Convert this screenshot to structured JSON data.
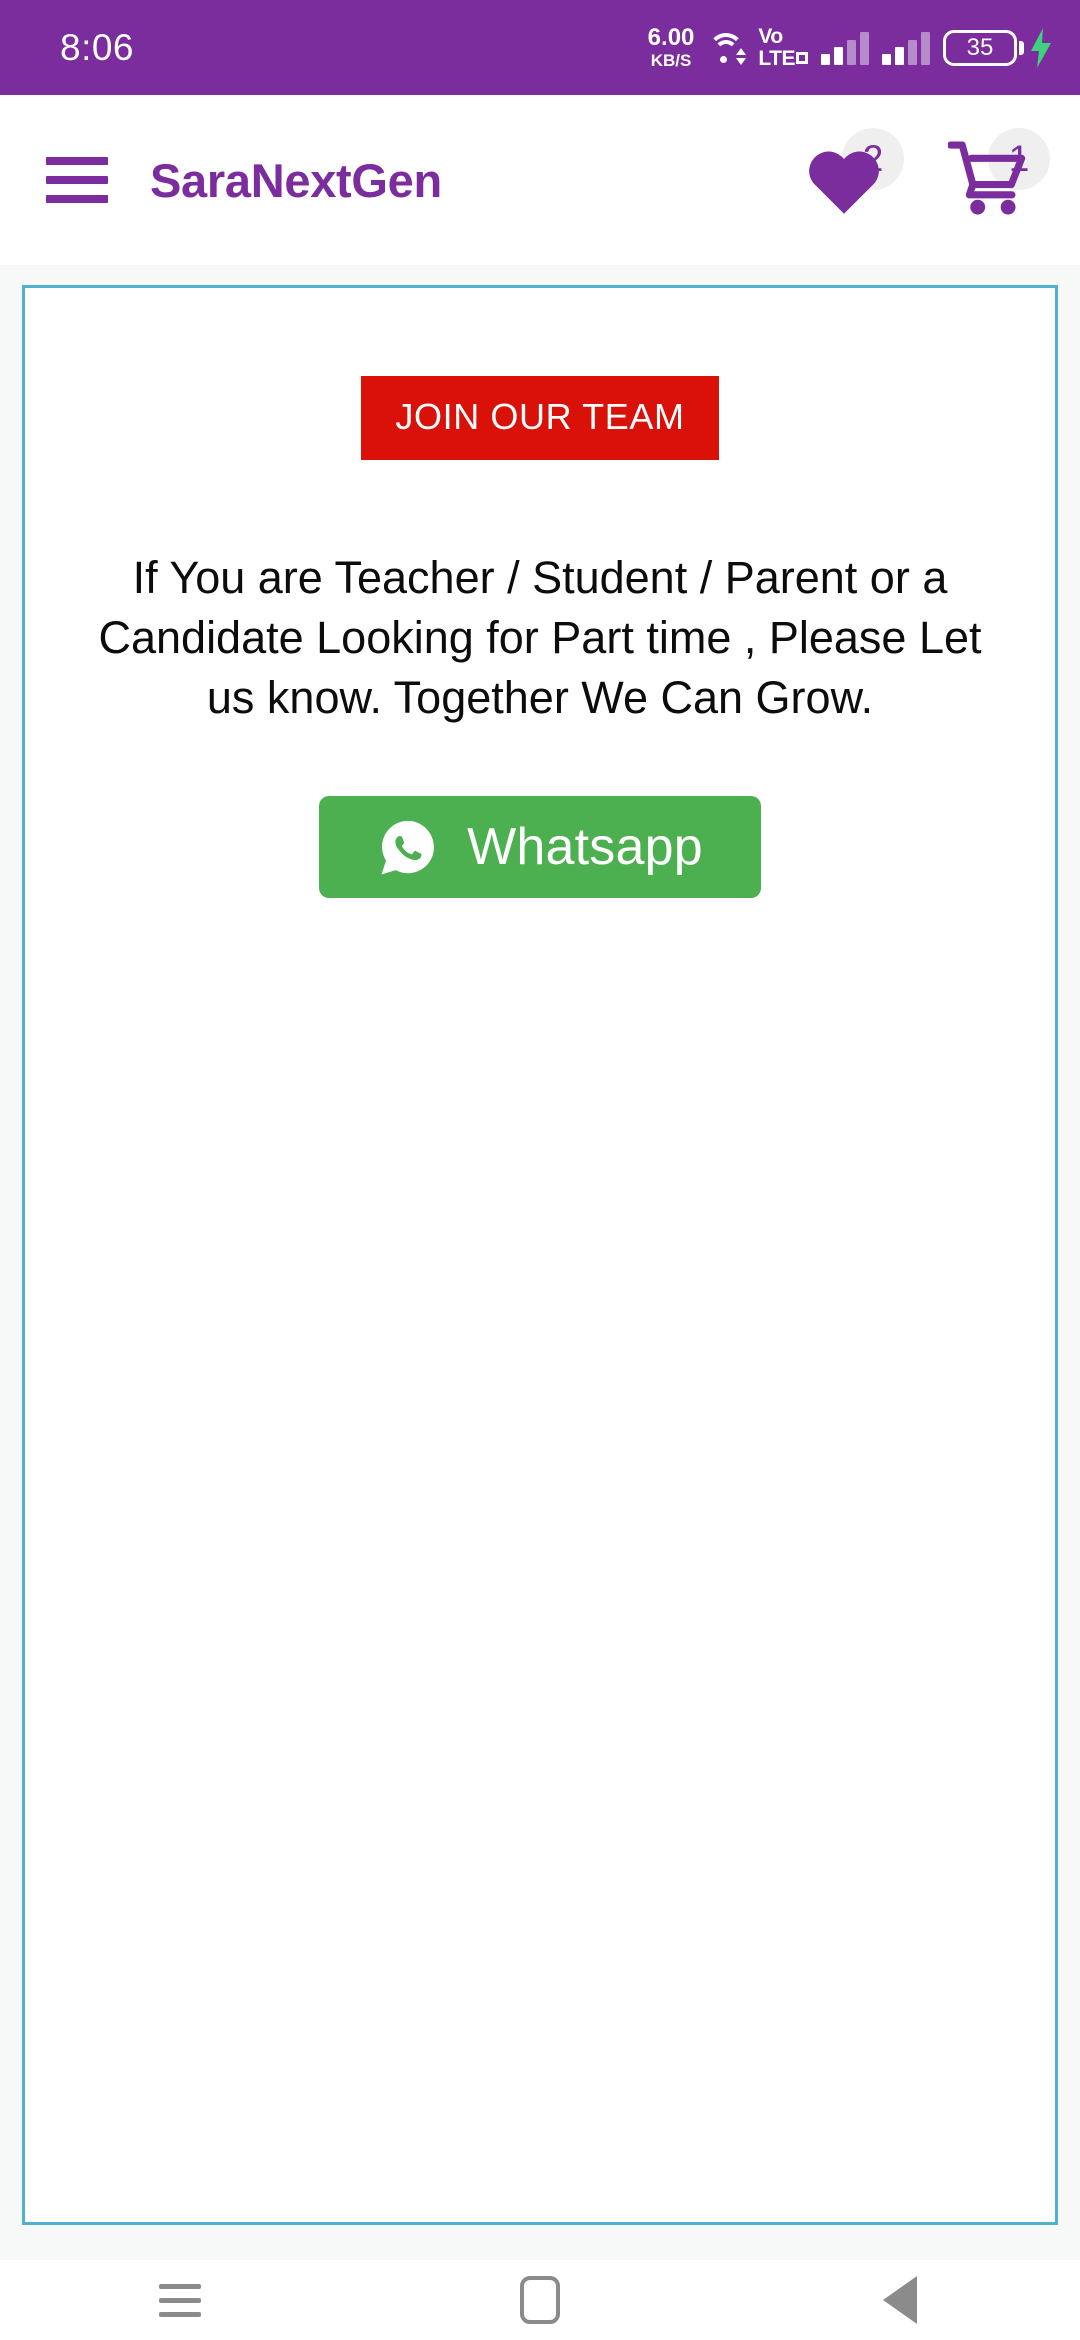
{
  "status_bar": {
    "clock": "8:06",
    "net_speed_value": "6.00",
    "net_speed_unit": "KB/S",
    "wifi_icon": "wifi-icon",
    "volte_line1": "Vo",
    "volte_line2": "LTE",
    "battery_level": "35",
    "charging_icon": "charging-bolt-icon",
    "background_color": "#7B2D9E",
    "foreground_color": "#FFFFFF"
  },
  "header": {
    "menu_icon": "hamburger-menu-icon",
    "brand": "SaraNextGen",
    "brand_color": "#7B2D9E",
    "wishlist": {
      "icon": "heart-icon",
      "badge": "2"
    },
    "cart": {
      "icon": "shopping-cart-icon",
      "badge": "1"
    }
  },
  "card": {
    "border_color": "#51B1CD",
    "join_button": {
      "label": "JOIN OUR TEAM",
      "background_color": "#D91109",
      "text_color": "#FFFFFF"
    },
    "message": "If You are Teacher / Student / Parent or a Candidate Looking for Part time , Please Let us know. Together We Can Grow.",
    "whatsapp_button": {
      "label": "Whatsapp",
      "icon": "whatsapp-icon",
      "background_color": "#4CAF50",
      "text_color": "#FFFFFF"
    }
  },
  "nav_bar": {
    "recent_label": "recent-apps",
    "home_label": "home",
    "back_label": "back"
  }
}
